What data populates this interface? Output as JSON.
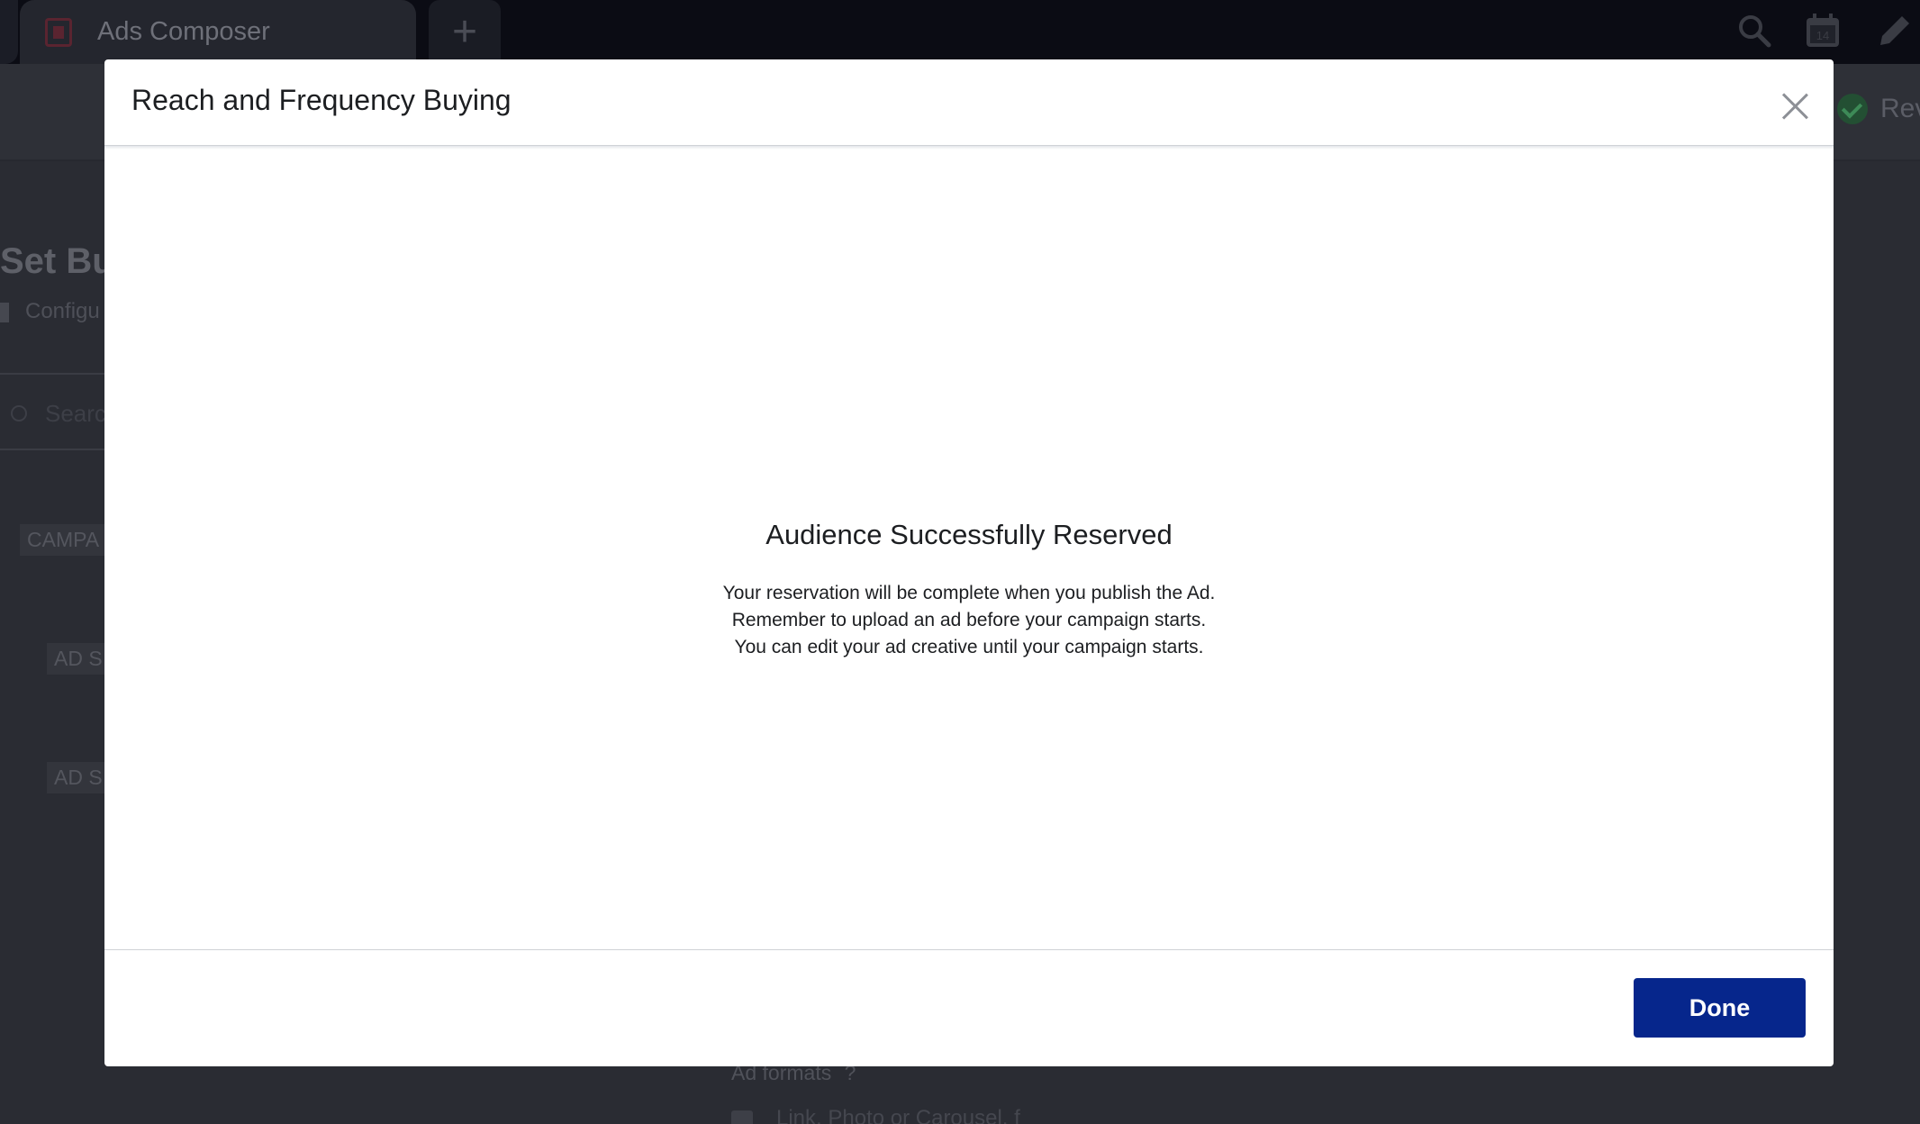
{
  "app_tab": {
    "title": "Ads Composer",
    "new_tab_label": "+"
  },
  "top_icons": [
    "search-icon",
    "calendar-icon",
    "pencil-icon"
  ],
  "calendar_day": "14",
  "background": {
    "review_label": "Rev",
    "page_title": "Set Buc",
    "page_subtitle": "Configu",
    "search_placeholder": "Searc",
    "tree_items": [
      "CAMPA",
      "AD S",
      "AD S"
    ],
    "ad_formats_label": "Ad formats",
    "ad_formats_info": "?",
    "ad_format_option": "Link, Photo or Carousel, f"
  },
  "modal": {
    "title": "Reach and Frequency Buying",
    "heading": "Audience Successfully Reserved",
    "body_lines": [
      "Your reservation will be complete when you publish the Ad.",
      "Remember to upload an ad before your campaign starts.",
      "You can edit your ad creative until your campaign starts."
    ],
    "done_label": "Done"
  },
  "colors": {
    "primary_button": "#06268c",
    "success": "#3d8a57"
  }
}
